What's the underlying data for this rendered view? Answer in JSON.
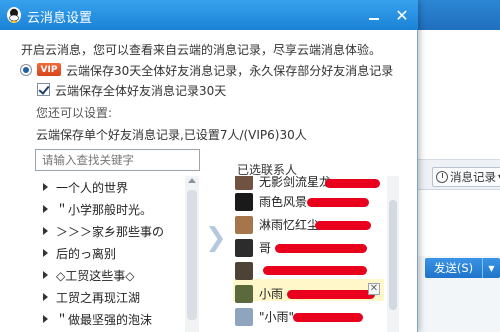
{
  "dialog": {
    "title": "云消息设置",
    "intro": "开启云消息，您可以查看来自云端的消息记录，尽享云端消息体验。",
    "vip_badge": "VIP",
    "vip_option": "云端保存30天全体好友消息记录，永久保存部分好友消息记录",
    "checkbox_label": "云端保存全体好友消息记录30天",
    "you_can_set": "您还可以设置:",
    "status_line": "云端保存单个好友消息记录,已设置7人/(VIP6)30人"
  },
  "search": {
    "placeholder": "请输入查找关键字"
  },
  "friend_list": [
    {
      "label": "一个人的世界"
    },
    {
      "label": "＂小学那般时光。"
    },
    {
      "label": "＞＞＞家乡那些事の"
    },
    {
      "label": "后的っ离别"
    },
    {
      "label": "◇工贸这些事◇"
    },
    {
      "label": "工贸之再现江湖"
    },
    {
      "label": "＂做最坚强的泡沫"
    }
  ],
  "selected": {
    "title": "已选联系人",
    "items": [
      {
        "name": "无影剑流星龙",
        "avatar_color": "#6f5240"
      },
      {
        "name": "雨色风景",
        "avatar_color": "#1a1a1a"
      },
      {
        "name": "淋雨忆红尘",
        "avatar_color": "#a5764a"
      },
      {
        "name": "哥",
        "avatar_color": "#2c2c2c"
      },
      {
        "name": "",
        "avatar_color": "#4d4236"
      },
      {
        "name": "小雨",
        "avatar_color": "#5b6a3d"
      },
      {
        "name": "\"小雨\"",
        "avatar_color": "#8fa4be"
      }
    ]
  },
  "background_window": {
    "history_label": "消息记录",
    "send_label": "发送(S)"
  },
  "colors": {
    "title_bar": "#1b82d6",
    "redaction": "#e8001c",
    "vip": "#e0532a"
  }
}
